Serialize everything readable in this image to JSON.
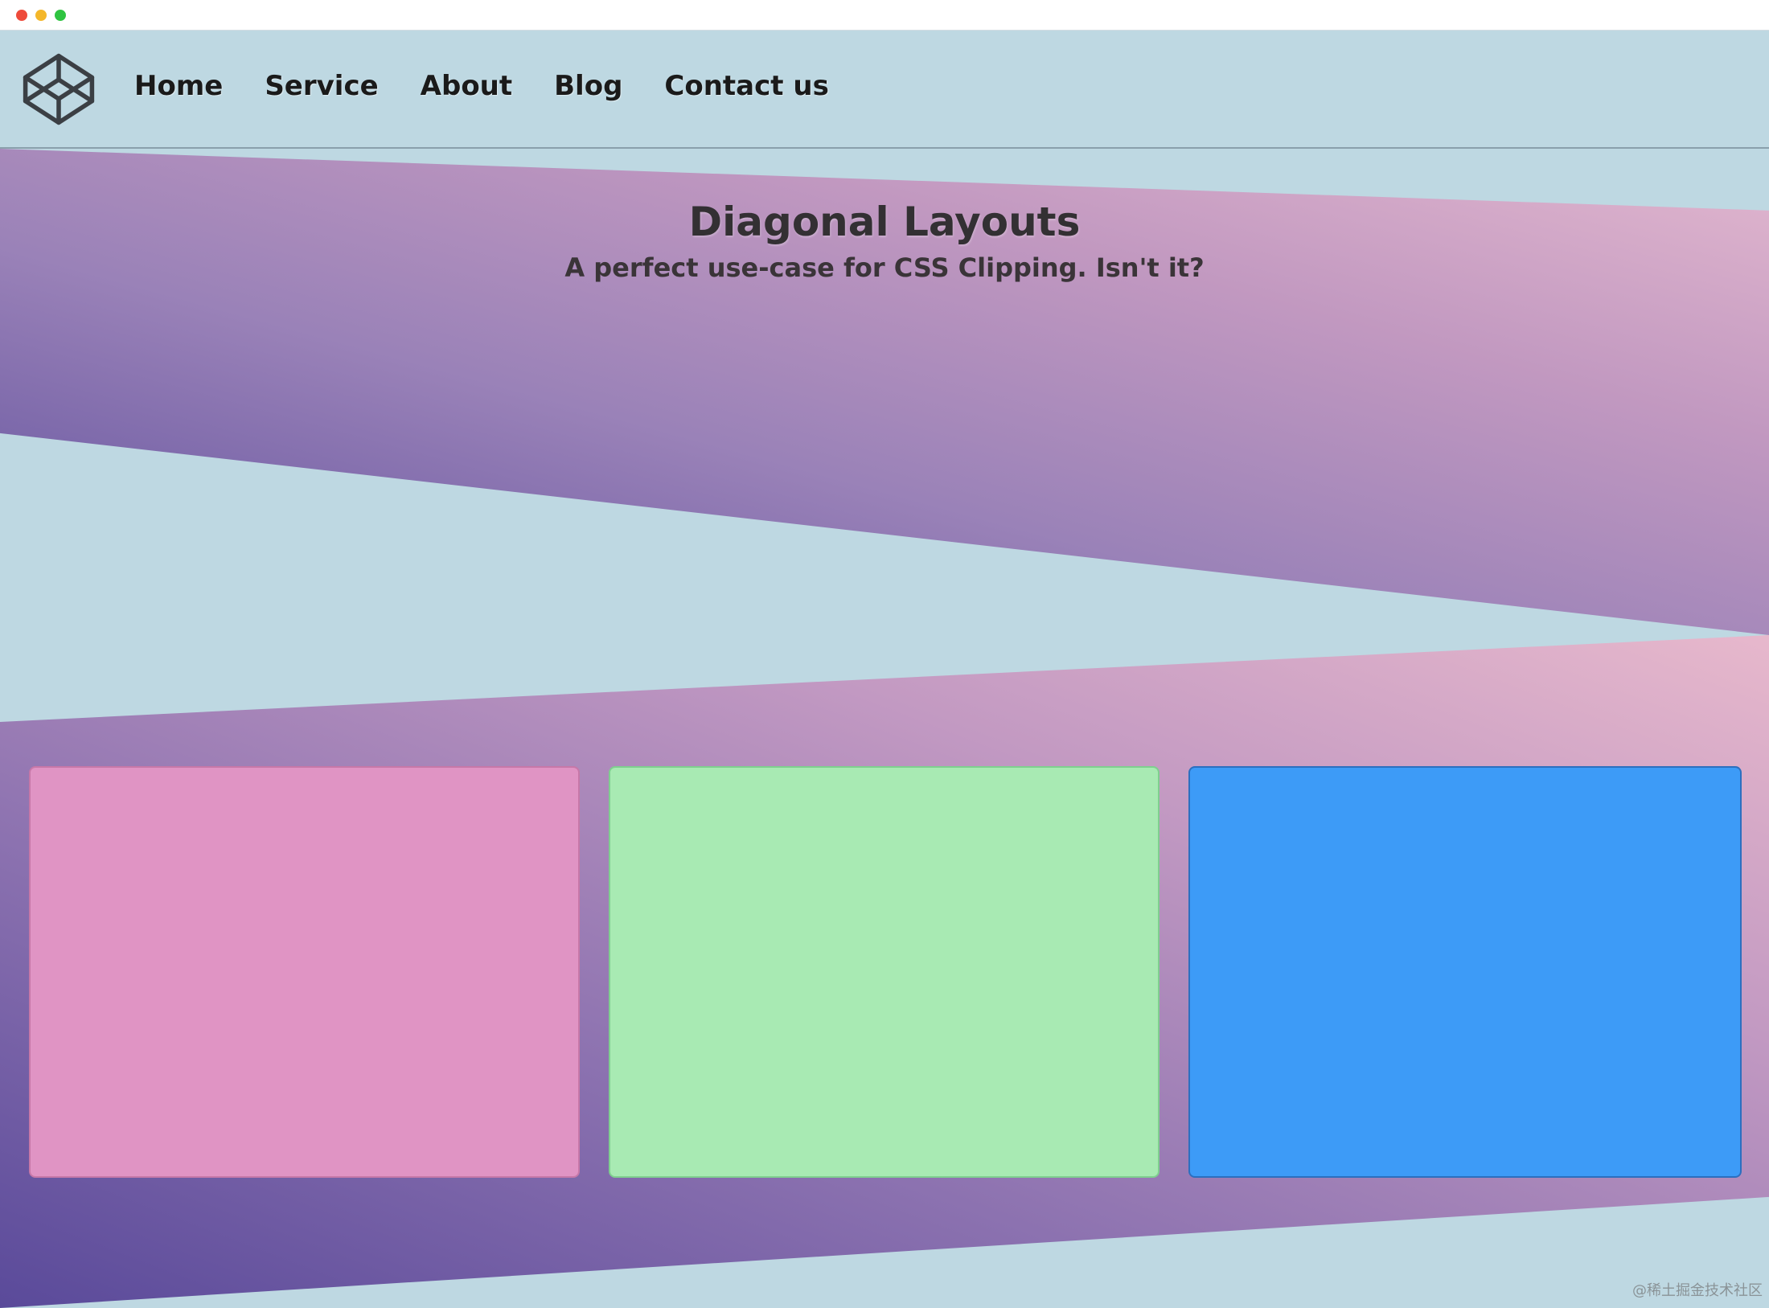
{
  "window": {
    "controls": [
      "close",
      "minimize",
      "maximize"
    ]
  },
  "navbar": {
    "logo_icon": "codepen-cube-icon",
    "links": [
      {
        "label": "Home"
      },
      {
        "label": "Service"
      },
      {
        "label": "About"
      },
      {
        "label": "Blog"
      },
      {
        "label": "Contact us"
      }
    ]
  },
  "hero": {
    "title": "Diagonal Layouts",
    "subtitle": "A perfect use-case for CSS Clipping. Isn't it?"
  },
  "cards": [
    {
      "color": "#e094c4"
    },
    {
      "color": "#a8eab3"
    },
    {
      "color": "#3d9bf7"
    }
  ],
  "colors": {
    "background": "#bed8e2",
    "gradient_start": "#5c4d9c",
    "gradient_end": "#e3b8cf",
    "text_dark": "#1a1a1a"
  },
  "watermark": "@稀土掘金技术社区"
}
